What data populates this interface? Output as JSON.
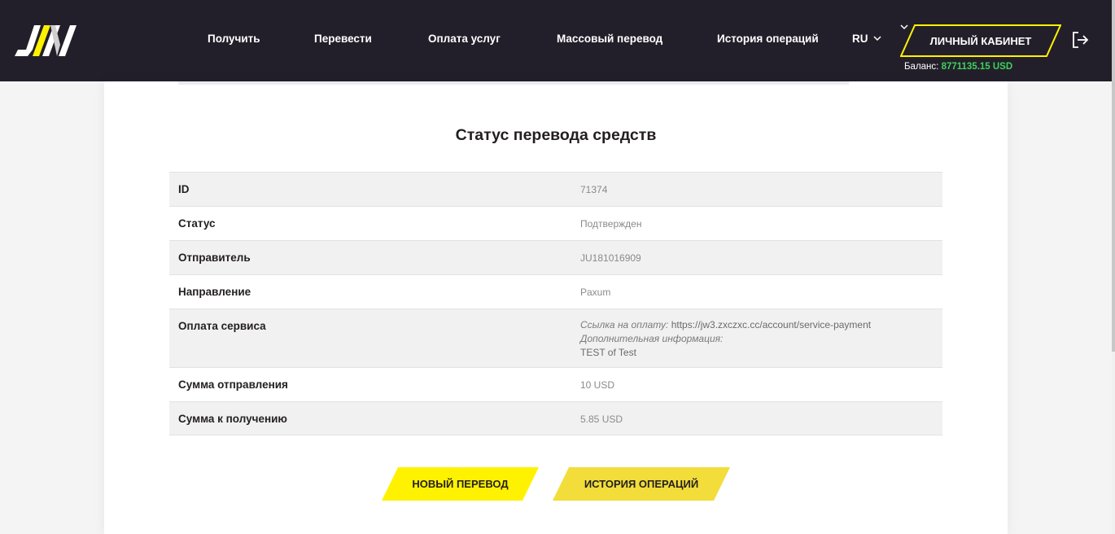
{
  "nav": {
    "items": [
      "Получить",
      "Перевести",
      "Оплата услуг",
      "Массовый перевод",
      "История операций"
    ],
    "lang": "RU",
    "cabinet_label": "ЛИЧНЫЙ КАБИНЕТ",
    "balance_label": "Баланс:",
    "balance_value": "8771135.15 USD"
  },
  "colors": {
    "header_bg": "#231f2a",
    "accent_yellow": "#fff200",
    "balance_green": "#3cd35a"
  },
  "page": {
    "title": "Статус перевода средств"
  },
  "details": {
    "rows": [
      {
        "label": "ID",
        "value": "71374"
      },
      {
        "label": "Статус",
        "value": "Подтвержден"
      },
      {
        "label": "Отправитель",
        "value": "JU181016909"
      },
      {
        "label": "Направление",
        "value": "Paxum"
      },
      {
        "label": "Оплата сервиса",
        "link_label": "Ссылка на оплату:",
        "link_value": "https://jw3.zxczxc.cc/account/service-payment",
        "info_label": "Дополнительная информация:",
        "info_value": "TEST of Test"
      },
      {
        "label": "Сумма отправления",
        "value": "10 USD"
      },
      {
        "label": "Сумма к получению",
        "value": "5.85 USD"
      }
    ]
  },
  "actions": {
    "new_transfer": "НОВЫЙ ПЕРЕВОД",
    "history": "ИСТОРИЯ ОПЕРАЦИЙ"
  },
  "icons": {
    "logo": "jw-logo",
    "lang_chevron": "chevron-down-icon",
    "logout": "logout-icon"
  }
}
